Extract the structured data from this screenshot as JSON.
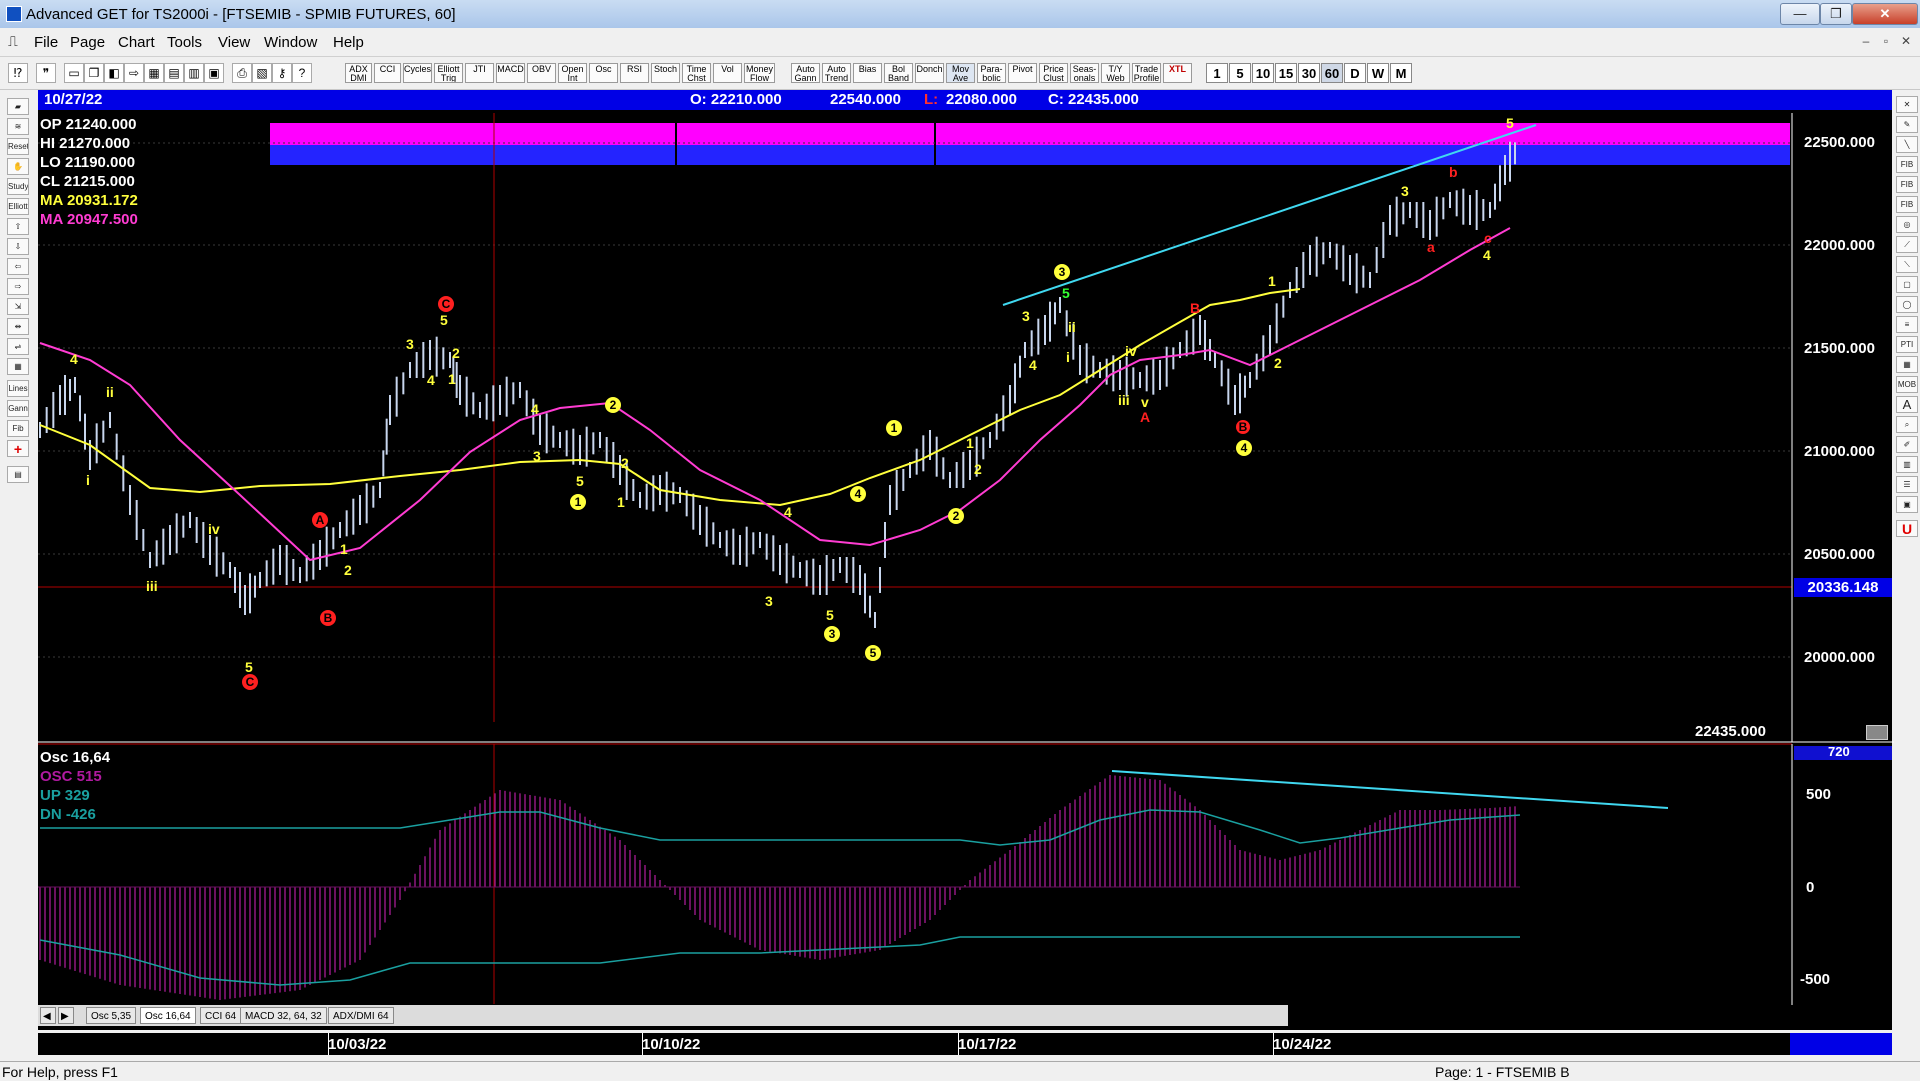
{
  "window": {
    "title": "Advanced GET for TS2000i - [FTSEMIB - SPMIB FUTURES, 60]",
    "buttons": [
      "—",
      "❐",
      "✕"
    ]
  },
  "menu": {
    "items": [
      "File",
      "Page",
      "Chart",
      "Tools",
      "View",
      "Window",
      "Help"
    ],
    "mdi_buttons": [
      "–",
      "▫",
      "✕"
    ]
  },
  "toolbar": {
    "study_buttons": [
      "ADX DMI",
      "CCI",
      "Cycles",
      "Elliott Trig",
      "JTI",
      "MACD",
      "OBV",
      "Open Int",
      "Osc",
      "RSI",
      "Stoch",
      "Time Chst",
      "Vol",
      "Money Flow",
      "Auto Gann",
      "Auto Trend",
      "Bias",
      "Bol Band",
      "Donch",
      "Mov Ave",
      "Para-bolic",
      "Pivot",
      "Price Clust",
      "Seas-onals",
      "T/Y Web",
      "Trade Profile",
      "XTL"
    ],
    "timeframes": [
      "1",
      "5",
      "10",
      "15",
      "30",
      "60",
      "D",
      "W",
      "M"
    ],
    "active_timeframe": "60"
  },
  "left_tools": [
    "Reset",
    "Study",
    "Elliott",
    "Lines",
    "Gann",
    "Fib"
  ],
  "right_tools": [
    "FIB RET",
    "FIB EXT",
    "FIB TIME",
    "PTI",
    "MOB",
    "A",
    "U"
  ],
  "chart": {
    "date": "10/27/22",
    "open": "O: 22210.000",
    "high": "22540.000",
    "low_label": "L:",
    "low": "22080.000",
    "close": "C: 22435.000",
    "cursor_info": {
      "op": "OP  21240.000",
      "hi": "HI   21270.000",
      "lo": "LO   21190.000",
      "cl": "CL   21215.000",
      "ma1": "MA  20931.172",
      "ma2": "MA  20947.500"
    },
    "price_axis": [
      "22500.000",
      "22000.000",
      "21500.000",
      "21000.000",
      "20500.000",
      "20000.000"
    ],
    "cursor_price": "20336.148",
    "last_price": "22435.000",
    "osc_panel": {
      "title": "Osc 16,64",
      "osc": "OSC 515",
      "up": "UP   329",
      "dn": "DN   -426",
      "axis": [
        "500",
        "0",
        "-500"
      ],
      "top_value": "720"
    },
    "tabs": [
      "Osc 5,35",
      "Osc 16,64",
      "CCI 64",
      "MACD 32, 64, 32",
      "ADX/DMI 64"
    ],
    "active_tab": "Osc 16,64",
    "dates": [
      "10/03/22",
      "10/10/22",
      "10/17/22",
      "10/24/22"
    ],
    "colors": {
      "background": "#000000",
      "info_bar": "#0000e6",
      "ma_fast": "#ffff3c",
      "ma_slow": "#ff3cd2",
      "trendline": "#40d8f0",
      "magenta_band": "#ff00ff",
      "blue_band": "#2020ff"
    }
  },
  "status": {
    "help": "For Help, press F1",
    "page": "Page: 1 - FTSEMIB B"
  }
}
